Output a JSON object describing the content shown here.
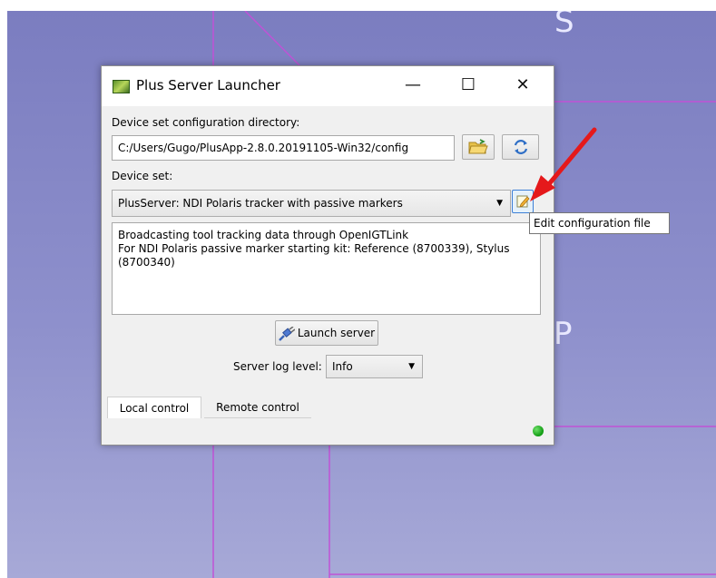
{
  "background": {
    "letters": [
      "S",
      "P"
    ],
    "color": "#7b7dc0",
    "line_color": "#c052d6"
  },
  "window": {
    "title": "Plus Server Launcher",
    "controls": {
      "minimize": "—",
      "maximize": "☐",
      "close": "✕"
    }
  },
  "config_dir": {
    "label": "Device set configuration directory:",
    "value": "C:/Users/Gugo/PlusApp-2.8.0.20191105-Win32/config",
    "open_icon": "folder-open-icon",
    "refresh_icon": "refresh-icon"
  },
  "device_set": {
    "label": "Device set:",
    "selected": "PlusServer: NDI Polaris tracker with passive markers",
    "edit_icon": "edit-config-icon",
    "description_lines": [
      "Broadcasting tool tracking data through OpenIGTLink",
      "For NDI Polaris passive marker starting kit: Reference (8700339), Stylus",
      "(8700340)"
    ]
  },
  "launch": {
    "label": "Launch server",
    "icon": "plug-icon"
  },
  "log_level": {
    "label": "Server log level:",
    "selected": "Info"
  },
  "tabs": [
    {
      "label": "Local control",
      "active": true
    },
    {
      "label": "Remote control",
      "active": false
    }
  ],
  "status": {
    "color": "#11a314"
  },
  "tooltip": {
    "text": "Edit configuration file"
  },
  "annotation": {
    "arrow_color": "#e5191b"
  }
}
